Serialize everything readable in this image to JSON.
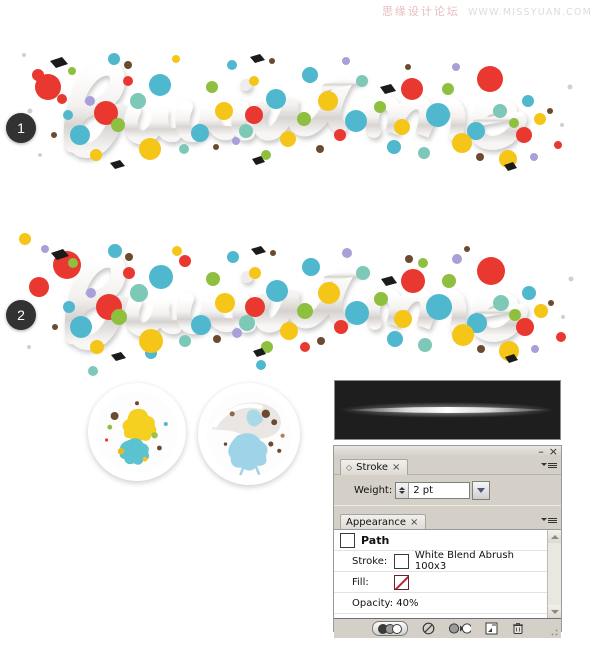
{
  "watermark": {
    "forum": "思缘设计论坛",
    "url": "WWW.MISSYUAN.COM"
  },
  "steps": [
    {
      "number": "1",
      "name": "step-1"
    },
    {
      "number": "2",
      "name": "step-2"
    }
  ],
  "artwork": {
    "word": "Paint me",
    "description": "3D glossy script lettering covered in multicolor paint splatters",
    "palette": [
      "#e8382f",
      "#f5c518",
      "#4fb8cf",
      "#7ec8b8",
      "#8fbf3f",
      "#b0413e",
      "#6b4a2f",
      "#a8a0d8",
      "#f07d2a"
    ]
  },
  "lenses": [
    {
      "name": "lens-detail-left"
    },
    {
      "name": "lens-detail-right"
    }
  ],
  "brush_preview": {
    "label": "brush-stroke-preview",
    "background": "#1e1e1f",
    "stroke_color": "#ffffff"
  },
  "panel": {
    "window": {
      "minimize": "–",
      "close": "×"
    },
    "stroke_panel": {
      "tab_label": "Stroke",
      "tab_close": "×",
      "weight_label": "Weight:",
      "weight_value": "2 pt"
    },
    "appearance_panel": {
      "tab_label": "Appearance",
      "tab_close": "×",
      "rows": [
        {
          "name": "Path"
        },
        {
          "key": "Stroke:",
          "value": "White Blend Abrush 100x3"
        },
        {
          "key": "Fill:",
          "value": ""
        },
        {
          "key": "Opacity: 40%",
          "value": ""
        }
      ],
      "path_label": "Path",
      "stroke_key": "Stroke:",
      "stroke_value": "White Blend Abrush 100x3",
      "fill_key": "Fill:",
      "opacity_label": "Opacity: 40%"
    },
    "footer": {
      "opacity_button": "opacity-toggle",
      "clear_button": "no-appearance",
      "duplicate_button": "duplicate-selected-item",
      "new_button": "new-art-has-basic-appearance",
      "delete_button": "delete-selected-item"
    }
  }
}
